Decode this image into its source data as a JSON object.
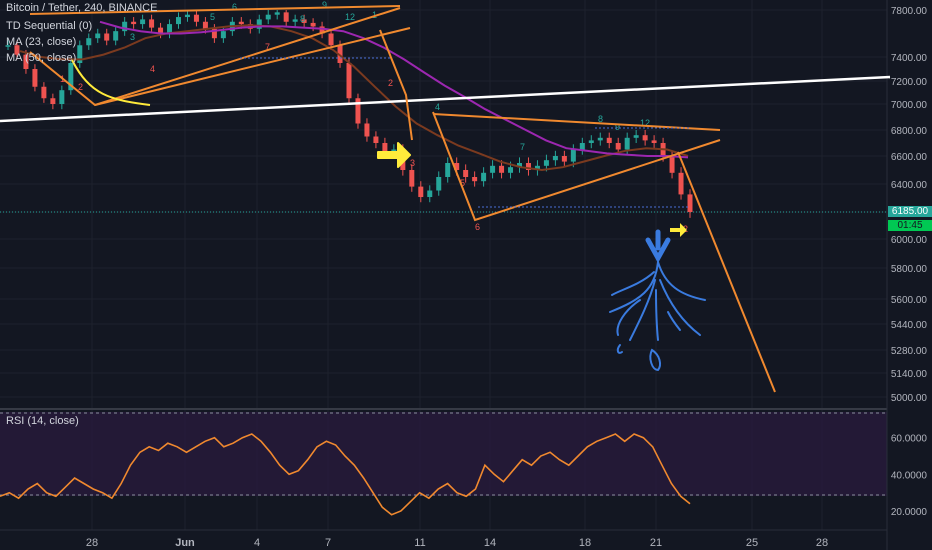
{
  "header": {
    "symbol_label": "Bitcoin / Tether, 240, BINANCE",
    "indicators": [
      "TD Sequential (0)",
      "MA (23, close)",
      "MA (50, close)"
    ],
    "rsi_label": "RSI (14, close)"
  },
  "last_price": {
    "value": "6185.00",
    "countdown": "01:45"
  },
  "colors": {
    "background": "#131722",
    "up_candle": "#26a69a",
    "down_candle": "#ef5350",
    "ma23": "#7b3a1f",
    "ma50": "#9c27b0",
    "trendline_orange": "#f0892f",
    "trendline_white": "#ffffff",
    "arrow_yellow": "#ffeb3b",
    "drawing_blue": "#2e6fd6",
    "rsi_line": "#f0892f",
    "rsi_band": "#2a1b3d",
    "price_tag": "#26a69a",
    "countdown_tag": "#00c853"
  },
  "chart_data": [
    {
      "type": "line",
      "title": "Bitcoin / Tether, 240, BINANCE",
      "x_tick_labels": [
        "28",
        "Jun",
        "4",
        "7",
        "11",
        "14",
        "18",
        "21",
        "25",
        "28"
      ],
      "y_tick_labels": [
        "7800.00",
        "7400.00",
        "7200.00",
        "7000.00",
        "6800.00",
        "6600.00",
        "6400.00",
        "6185.00",
        "6000.00",
        "5800.00",
        "5600.00",
        "5440.00",
        "5280.00",
        "5140.00",
        "5000.00"
      ],
      "ylim": [
        4960,
        7860
      ],
      "series": [
        {
          "name": "price",
          "values": [
            7500,
            7420,
            7300,
            7150,
            7050,
            7000,
            7120,
            7350,
            7500,
            7560,
            7600,
            7540,
            7620,
            7700,
            7680,
            7720,
            7650,
            7600,
            7680,
            7740,
            7760,
            7700,
            7640,
            7560,
            7620,
            7700,
            7680,
            7640,
            7720,
            7760,
            7780,
            7700,
            7720,
            7690,
            7660,
            7600,
            7500,
            7350,
            7050,
            6850,
            6750,
            6700,
            6620,
            6650,
            6500,
            6380,
            6300,
            6350,
            6450,
            6550,
            6500,
            6450,
            6420,
            6480,
            6530,
            6480,
            6520,
            6550,
            6500,
            6530,
            6570,
            6600,
            6560,
            6650,
            6700,
            6720,
            6740,
            6700,
            6650,
            6740,
            6760,
            6720,
            6700,
            6600,
            6480,
            6320,
            6185
          ]
        },
        {
          "name": "MA (23, close)",
          "values": [
            7450,
            7400,
            7380,
            7380,
            7420,
            7480,
            7560,
            7600,
            7620,
            7640,
            7660,
            7670,
            7660,
            7620,
            7560,
            7460,
            7320,
            7150,
            6980,
            6850,
            6760,
            6680,
            6620,
            6560,
            6520,
            6500,
            6520,
            6560,
            6600,
            6640,
            6660,
            6650,
            6600
          ]
        },
        {
          "name": "MA (50, close)",
          "values": [
            7700,
            7650,
            7620,
            7600,
            7600,
            7610,
            7630,
            7650,
            7660,
            7660,
            7650,
            7640,
            7620,
            7560,
            7480,
            7380,
            7270,
            7160,
            7060,
            6960,
            6880,
            6800,
            6720,
            6660,
            6640,
            6620,
            6610,
            6600,
            6600,
            6590
          ]
        }
      ],
      "annotations": [
        "1",
        "2",
        "3",
        "4",
        "5",
        "6",
        "7",
        "8",
        "9",
        "12"
      ]
    },
    {
      "type": "line",
      "title": "RSI (14, close)",
      "y_tick_labels": [
        "60.0000",
        "40.0000",
        "20.0000"
      ],
      "ylim": [
        14,
        74
      ],
      "band": [
        30,
        70
      ],
      "values": [
        28,
        30,
        27,
        32,
        35,
        30,
        28,
        33,
        38,
        35,
        32,
        30,
        27,
        35,
        45,
        52,
        55,
        53,
        57,
        55,
        52,
        55,
        58,
        60,
        55,
        57,
        60,
        62,
        58,
        52,
        45,
        40,
        42,
        48,
        55,
        58,
        56,
        50,
        45,
        38,
        30,
        22,
        18,
        20,
        25,
        30,
        27,
        32,
        35,
        30,
        28,
        32,
        45,
        40,
        36,
        42,
        48,
        45,
        50,
        52,
        48,
        45,
        50,
        55,
        58,
        60,
        62,
        58,
        62,
        60,
        55,
        45,
        35,
        28,
        24
      ]
    }
  ]
}
